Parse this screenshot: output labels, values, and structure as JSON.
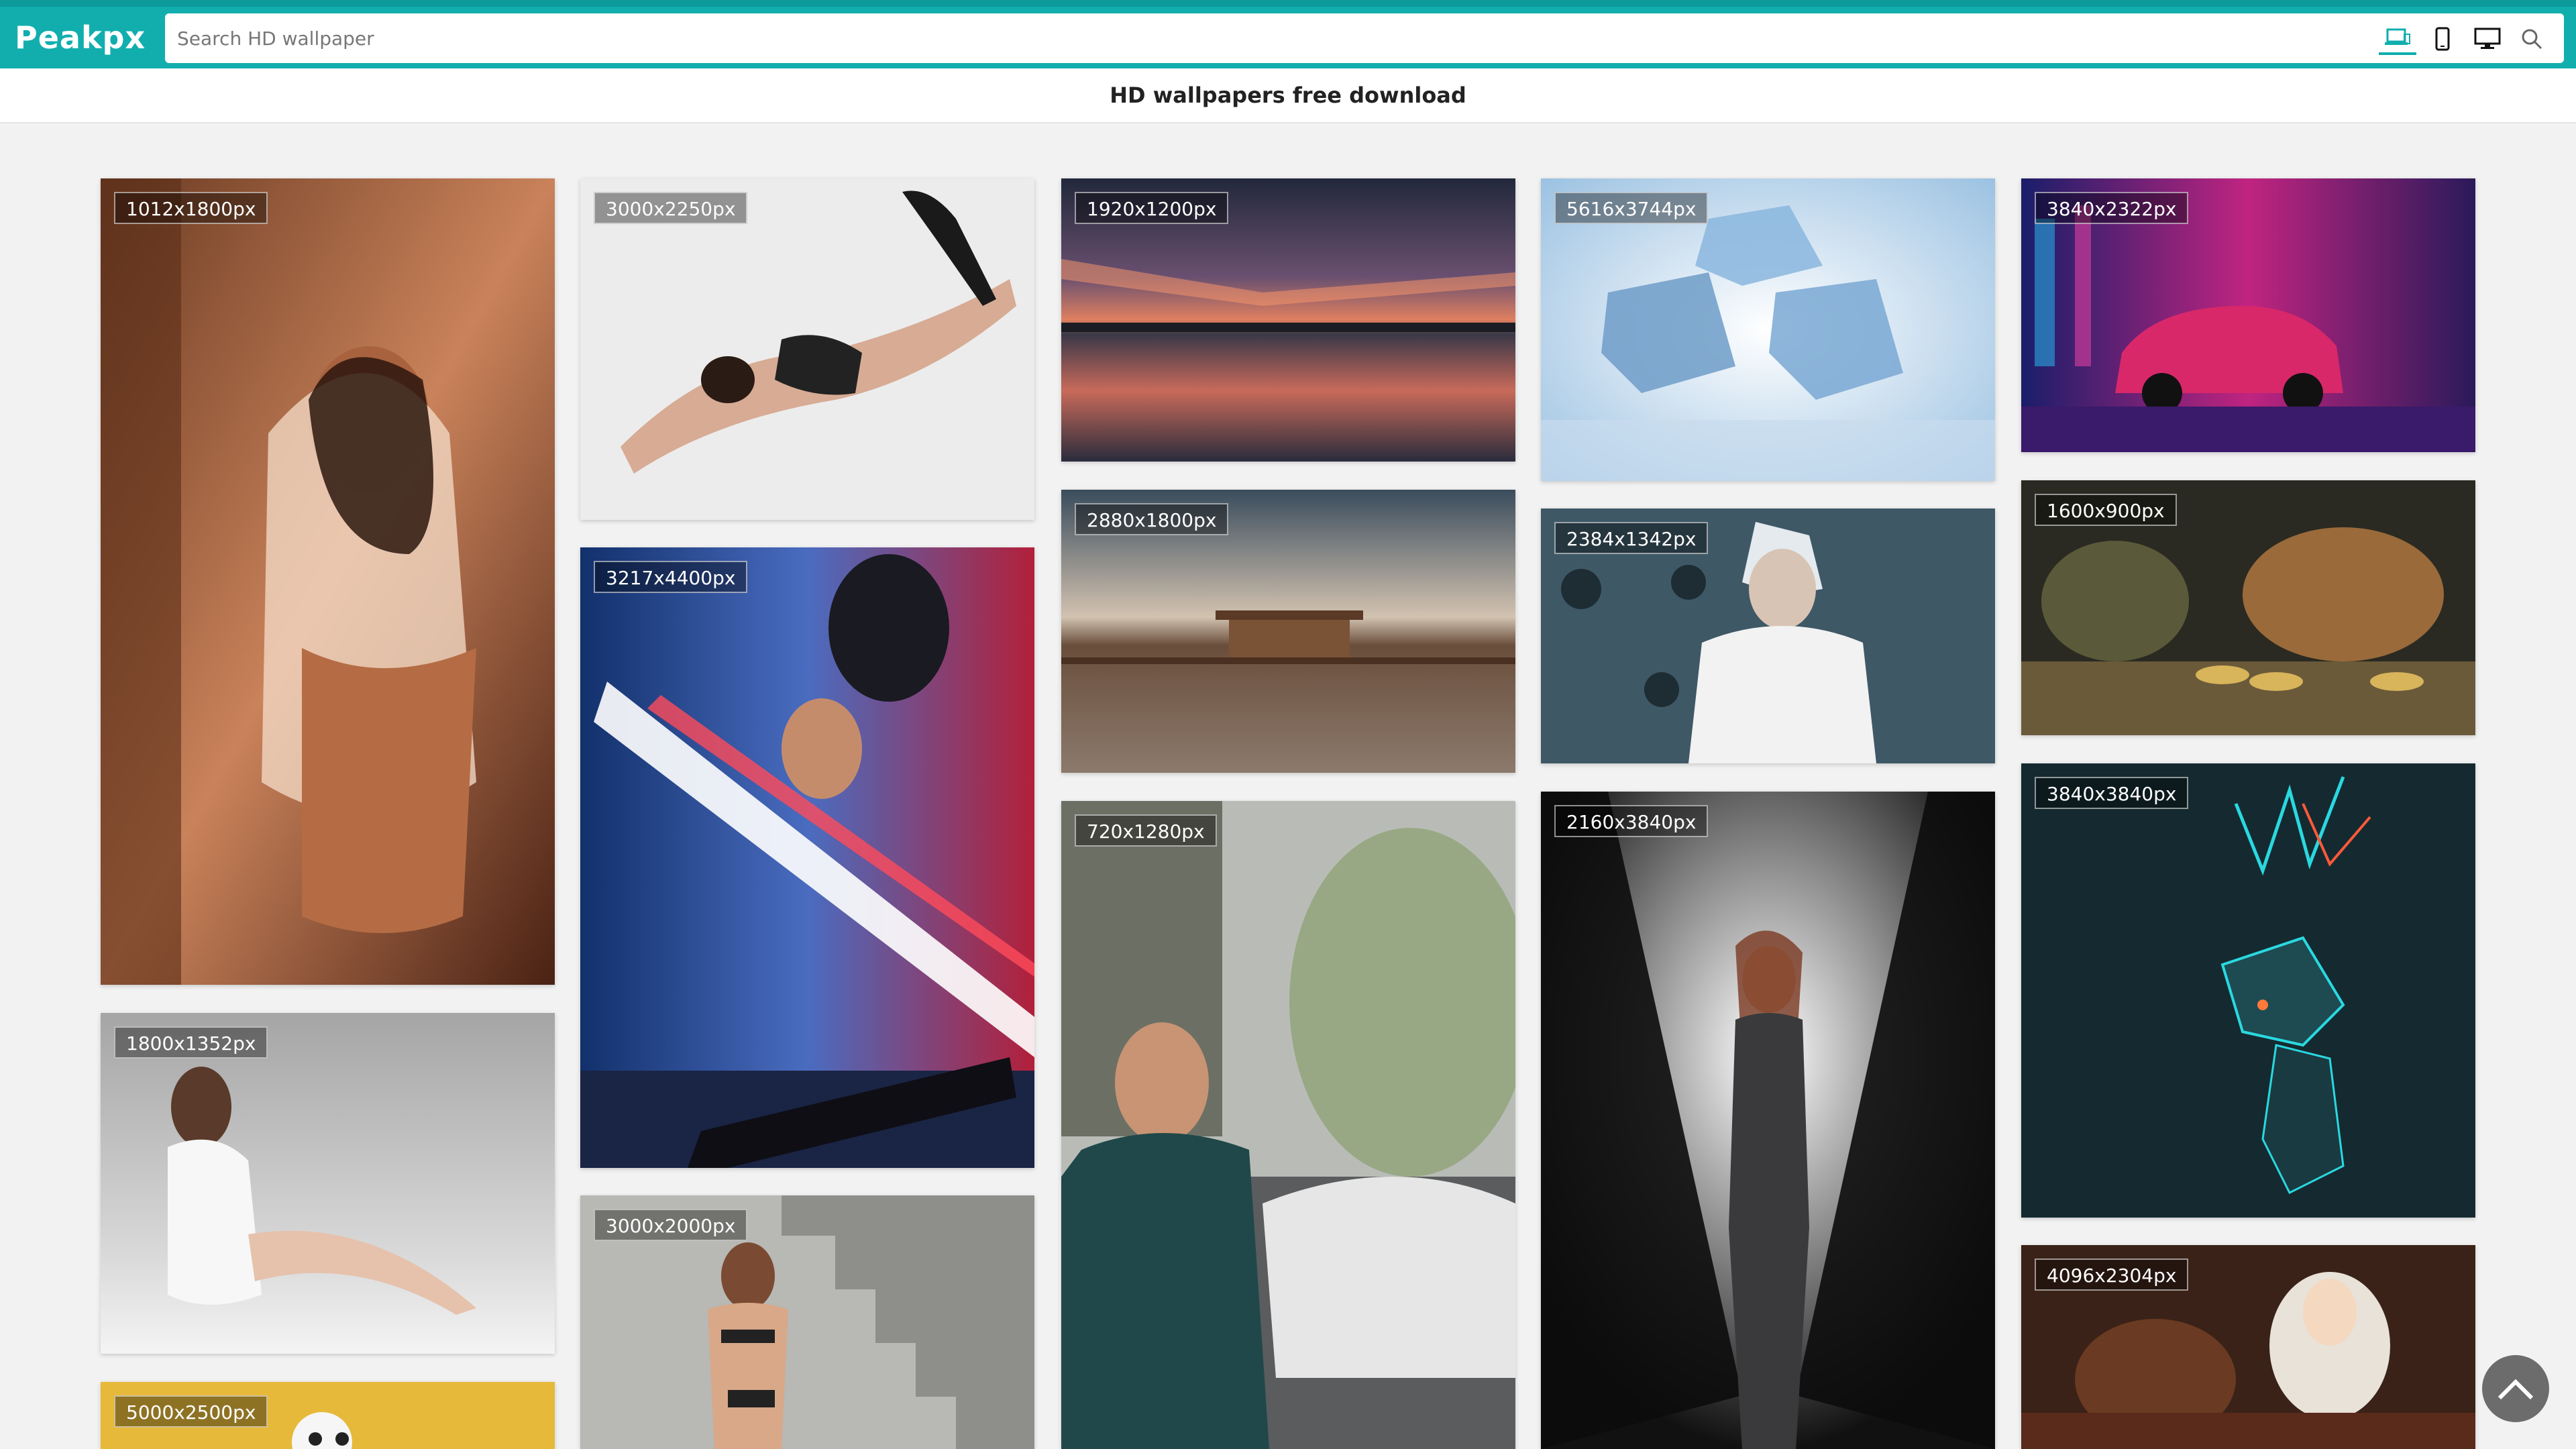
{
  "header": {
    "logo": "Peakpx",
    "search_placeholder": "Search HD wallpaper",
    "device_icons": [
      "laptop-icon",
      "phone-icon",
      "desktop-icon"
    ],
    "search_icon": "search-icon",
    "accent": "#12aeae"
  },
  "page": {
    "title": "HD wallpapers free download"
  },
  "wallpapers": [
    {
      "res": "1012x1800px",
      "subject": "woman-portrait-warm"
    },
    {
      "res": "1800x1352px",
      "subject": "woman-seated-white"
    },
    {
      "res": "5000x2500px",
      "subject": "yellow-cartoon"
    },
    {
      "res": "3000x2250px",
      "subject": "lingerie-model"
    },
    {
      "res": "3217x4400px",
      "subject": "star-wars-poster"
    },
    {
      "res": "3000x2000px",
      "subject": "swimwear-model-stairs"
    },
    {
      "res": "1920x1200px",
      "subject": "sunset-reflection"
    },
    {
      "res": "2880x1800px",
      "subject": "monument-sky"
    },
    {
      "res": "720x1280px",
      "subject": "man-with-car"
    },
    {
      "res": "5616x3744px",
      "subject": "ice-cubes"
    },
    {
      "res": "2384x1342px",
      "subject": "anime-character"
    },
    {
      "res": "2160x3840px",
      "subject": "black-widow"
    },
    {
      "res": "3840x2322px",
      "subject": "neon-porsche"
    },
    {
      "res": "1600x900px",
      "subject": "bulls-coins"
    },
    {
      "res": "3840x3840px",
      "subject": "neon-deer"
    },
    {
      "res": "4096x2304px",
      "subject": "fantasy-art"
    }
  ],
  "scroll_top_icon": "chevron-up-icon"
}
